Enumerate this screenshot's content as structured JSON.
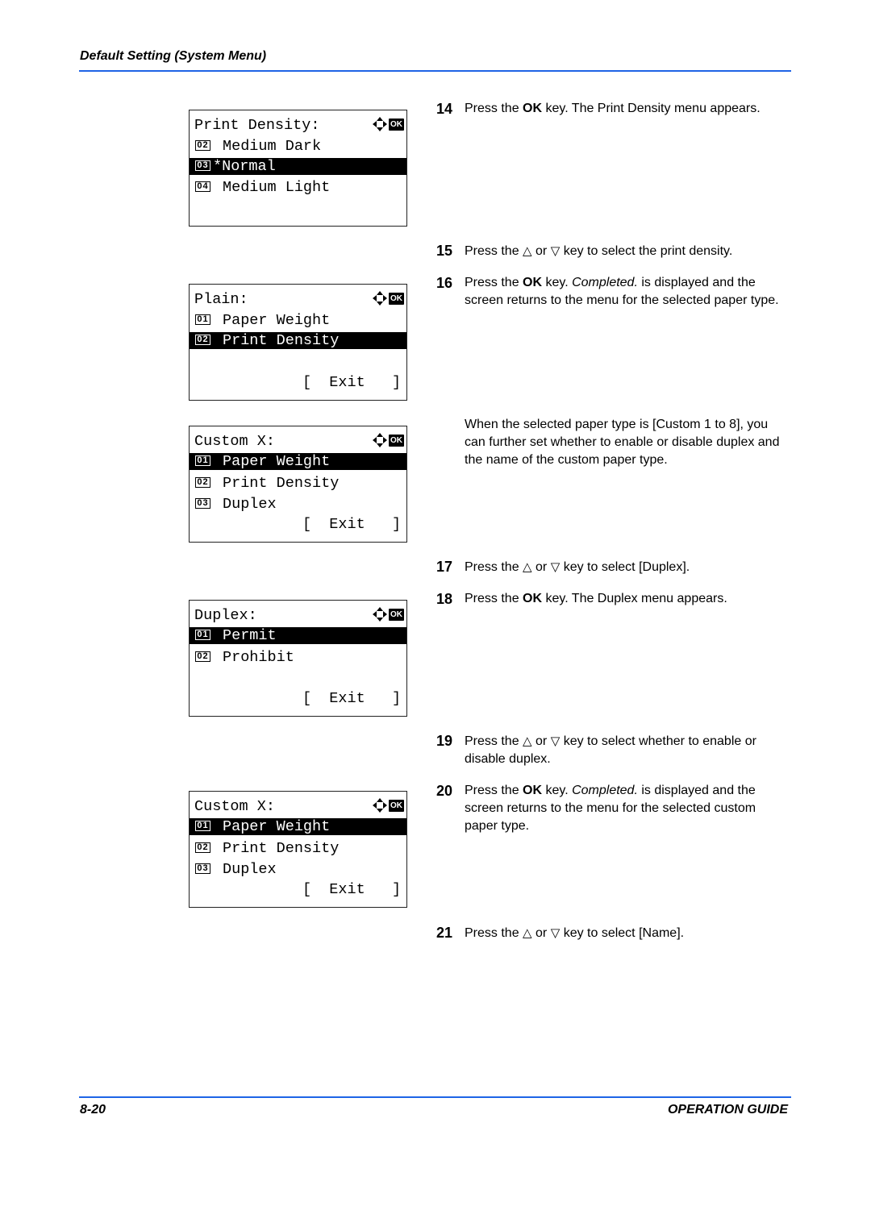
{
  "header": {
    "title": "Default Setting (System Menu)"
  },
  "footer": {
    "page_number": "8-20",
    "guide_name": "OPERATION GUIDE"
  },
  "colors": {
    "rule": "#1e64e6"
  },
  "icons": {
    "nav": "four-way-arrow-icon",
    "ok": "OK",
    "up_key": "△",
    "down_key": "▽"
  },
  "screens": [
    {
      "title": "Print Density:",
      "items": [
        {
          "badge": "02",
          "label": "Medium Dark",
          "selected": false
        },
        {
          "badge": "03",
          "label": "*Normal",
          "selected": true
        },
        {
          "badge": "04",
          "label": "Medium Light",
          "selected": false
        }
      ],
      "exit": ""
    },
    {
      "title": "Plain:",
      "items": [
        {
          "badge": "01",
          "label": "Paper Weight",
          "selected": false
        },
        {
          "badge": "02",
          "label": "Print Density",
          "selected": true
        }
      ],
      "exit": "[  Exit   ]"
    },
    {
      "title": "Custom X:",
      "items": [
        {
          "badge": "01",
          "label": "Paper Weight",
          "selected": true
        },
        {
          "badge": "02",
          "label": "Print Density",
          "selected": false
        },
        {
          "badge": "03",
          "label": "Duplex",
          "selected": false
        }
      ],
      "exit": "[  Exit   ]"
    },
    {
      "title": "Duplex:",
      "items": [
        {
          "badge": "01",
          "label": "Permit",
          "selected": true
        },
        {
          "badge": "02",
          "label": "Prohibit",
          "selected": false
        }
      ],
      "exit": "[  Exit   ]"
    },
    {
      "title": "Custom X:",
      "items": [
        {
          "badge": "01",
          "label": "Paper Weight",
          "selected": true
        },
        {
          "badge": "02",
          "label": "Print Density",
          "selected": false
        },
        {
          "badge": "03",
          "label": "Duplex",
          "selected": false
        }
      ],
      "exit": "[  Exit   ]"
    }
  ],
  "steps": [
    {
      "num": "14",
      "parts": [
        "Press the ",
        {
          "b": "OK"
        },
        " key. The Print Density menu appears."
      ]
    },
    {
      "num": "15",
      "parts": [
        "Press the ",
        {
          "tri": "△"
        },
        " or ",
        {
          "tri": "▽"
        },
        " key to select the print density."
      ]
    },
    {
      "num": "16",
      "parts": [
        "Press the ",
        {
          "b": "OK"
        },
        " key. ",
        {
          "i": "Completed."
        },
        " is displayed and the screen returns to the menu for the selected paper type."
      ]
    },
    {
      "num": "",
      "parts": [
        "When the selected paper type is [Custom 1 to 8], you can further set whether to enable or disable duplex and the name of the custom paper type."
      ]
    },
    {
      "num": "17",
      "parts": [
        "Press the ",
        {
          "tri": "△"
        },
        " or ",
        {
          "tri": "▽"
        },
        " key to select [Duplex]."
      ]
    },
    {
      "num": "18",
      "parts": [
        "Press the ",
        {
          "b": "OK"
        },
        " key. The Duplex menu appears."
      ]
    },
    {
      "num": "19",
      "parts": [
        "Press the ",
        {
          "tri": "△"
        },
        " or ",
        {
          "tri": "▽"
        },
        " key to select whether to enable or disable duplex."
      ]
    },
    {
      "num": "20",
      "parts": [
        "Press the ",
        {
          "b": "OK"
        },
        " key. ",
        {
          "i": "Completed."
        },
        " is displayed and the screen returns to the menu for the selected custom paper type."
      ]
    },
    {
      "num": "21",
      "parts": [
        "Press the ",
        {
          "tri": "△"
        },
        " or ",
        {
          "tri": "▽"
        },
        " key to select [Name]."
      ]
    }
  ]
}
